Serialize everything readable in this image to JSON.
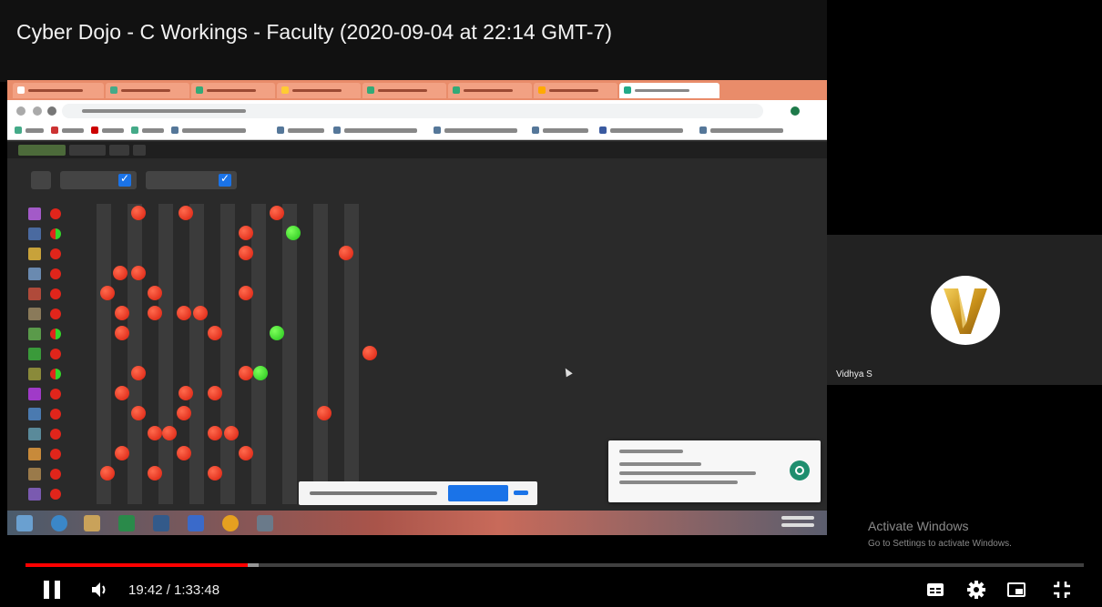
{
  "video": {
    "title": "Cyber Dojo - C Workings - Faculty (2020-09-04 at 22:14 GMT-7)"
  },
  "participant": {
    "name": "Vidhya S"
  },
  "watermark": {
    "title": "Activate Windows",
    "subtitle": "Go to Settings to activate Windows."
  },
  "player": {
    "current_time": "19:42",
    "duration": "1:33:48",
    "time_display": "19:42 / 1:33:48",
    "played_fraction": 0.2103,
    "buffered_fraction": 0.22
  },
  "icons": {
    "pause": "pause-icon",
    "volume": "volume-icon",
    "subtitles": "subtitles-icon",
    "settings": "settings-gear-icon",
    "miniplayer": "miniplayer-icon",
    "exit_fullscreen": "exit-fullscreen-icon"
  },
  "colors": {
    "progress_played": "#ff0000",
    "traffic_red": "#e0251b",
    "traffic_green": "#35d62a",
    "check_blue": "#1a73e8",
    "avatar_gold": "#d4a017"
  }
}
